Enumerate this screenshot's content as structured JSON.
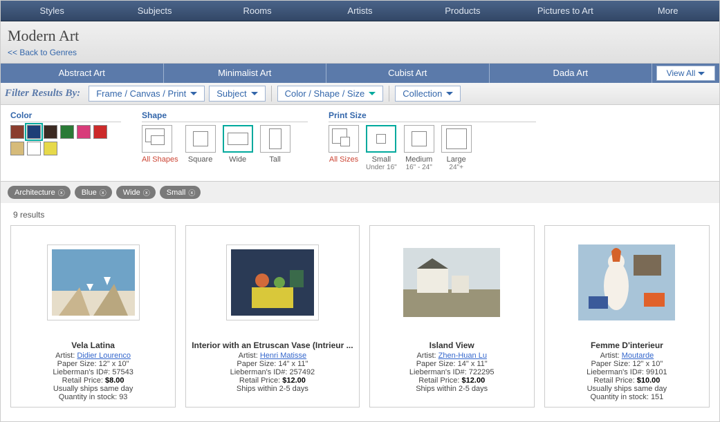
{
  "topnav": [
    "Styles",
    "Subjects",
    "Rooms",
    "Artists",
    "Products",
    "Pictures to Art",
    "More"
  ],
  "title": "Modern Art",
  "back_label": "<< Back to Genres",
  "subnav": [
    "Abstract Art",
    "Minimalist Art",
    "Cubist Art",
    "Dada Art"
  ],
  "viewall_label": "View All",
  "filter_label": "Filter Results By:",
  "filter_dropdowns": {
    "framePrint": "Frame / Canvas / Print",
    "subject": "Subject",
    "colorShape": "Color / Shape / Size",
    "collection": "Collection"
  },
  "panel": {
    "color_heading": "Color",
    "shape_heading": "Shape",
    "size_heading": "Print Size",
    "shapes": {
      "all": "All Shapes",
      "square": "Square",
      "wide": "Wide",
      "tall": "Tall"
    },
    "sizes": {
      "all": "All Sizes",
      "small": "Small",
      "small_sub": "Under 16\"",
      "medium": "Medium",
      "medium_sub": "16\" - 24\"",
      "large": "Large",
      "large_sub": "24\"+"
    },
    "swatch_colors": [
      "#8a3d2e",
      "#1d3f77",
      "#3b2a22",
      "#2a7a36",
      "#d83c7a",
      "#cc2a2a",
      "#d6bb7a",
      "#ffffff",
      "#e6d94a"
    ]
  },
  "chips": [
    "Architecture",
    "Blue",
    "Wide",
    "Small"
  ],
  "results_count": "9 results",
  "labels": {
    "artist": "Artist:",
    "paper": "Paper Size:",
    "lieb": "Lieberman's ID#:",
    "retail": "Retail Price:",
    "ships": "Ships",
    "stock": "Quantity in stock:"
  },
  "products": [
    {
      "title": "Vela Latina",
      "artist": "Didier Lourenco",
      "paper": "12\" x 10\"",
      "lieb": "57543",
      "price": "$8.00",
      "ship": "Usually ships same day",
      "stock": "93"
    },
    {
      "title": "Interior with an Etruscan Vase (Intrieur ...",
      "artist": "Henri Matisse",
      "paper": "14\" x 11\"",
      "lieb": "257492",
      "price": "$12.00",
      "ship": "Ships within 2-5 days",
      "stock": ""
    },
    {
      "title": "Island View",
      "artist": "Zhen-Huan Lu",
      "paper": "14\" x 11\"",
      "lieb": "722295",
      "price": "$12.00",
      "ship": "Ships within 2-5 days",
      "stock": ""
    },
    {
      "title": "Femme D'interieur",
      "artist": "Moutarde",
      "paper": "12\" x 10\"",
      "lieb": "99101",
      "price": "$10.00",
      "ship": "Usually ships same day",
      "stock": "151"
    }
  ]
}
